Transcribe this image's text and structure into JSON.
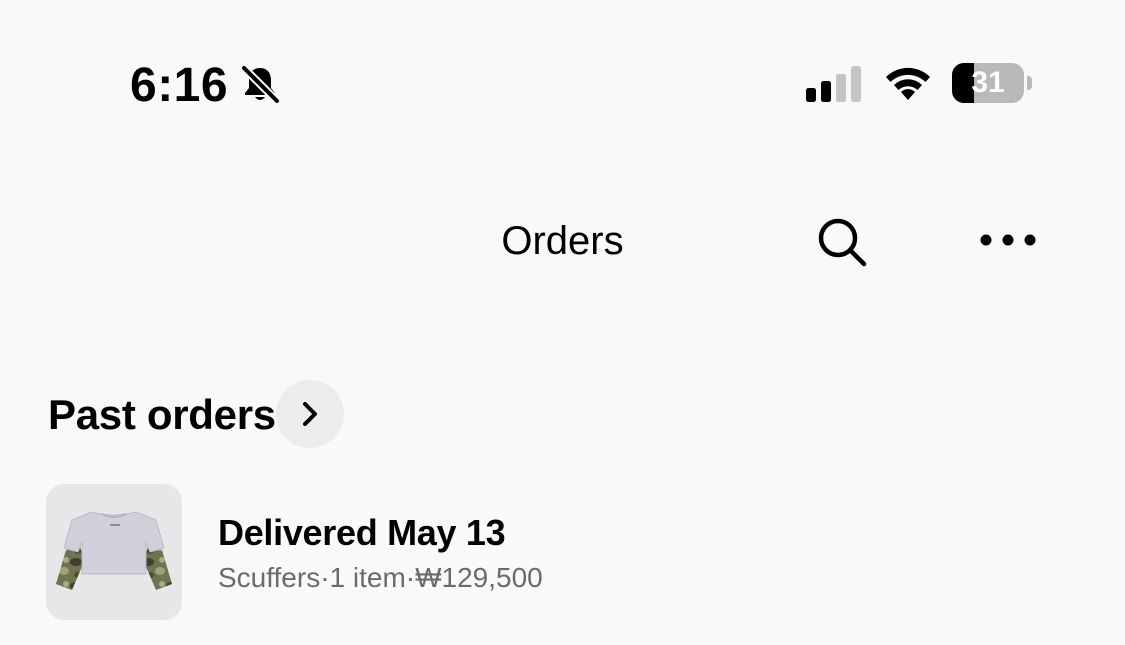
{
  "status_bar": {
    "time": "6:16",
    "battery_level": "31",
    "battery_fraction": 0.31,
    "notifications_muted_icon": "bell-slash-icon",
    "signal_icon": "cellular-signal-icon",
    "wifi_icon": "wifi-icon"
  },
  "nav": {
    "title": "Orders",
    "search_icon": "search-icon",
    "more_icon": "more-horizontal-icon"
  },
  "past_orders": {
    "title": "Past orders",
    "chevron_icon": "chevron-right-icon",
    "orders": [
      {
        "status": "Delivered May 13",
        "meta": "Scuffers·1 item·₩129,500",
        "thumbnail": "shirt-camo-sleeves"
      }
    ]
  },
  "colors": {
    "background": "#f9f9f9",
    "text_primary": "#000000",
    "text_secondary": "#6b6b6b",
    "chip_background": "#ececef",
    "thumbnail_background": "#e7e7e9"
  }
}
